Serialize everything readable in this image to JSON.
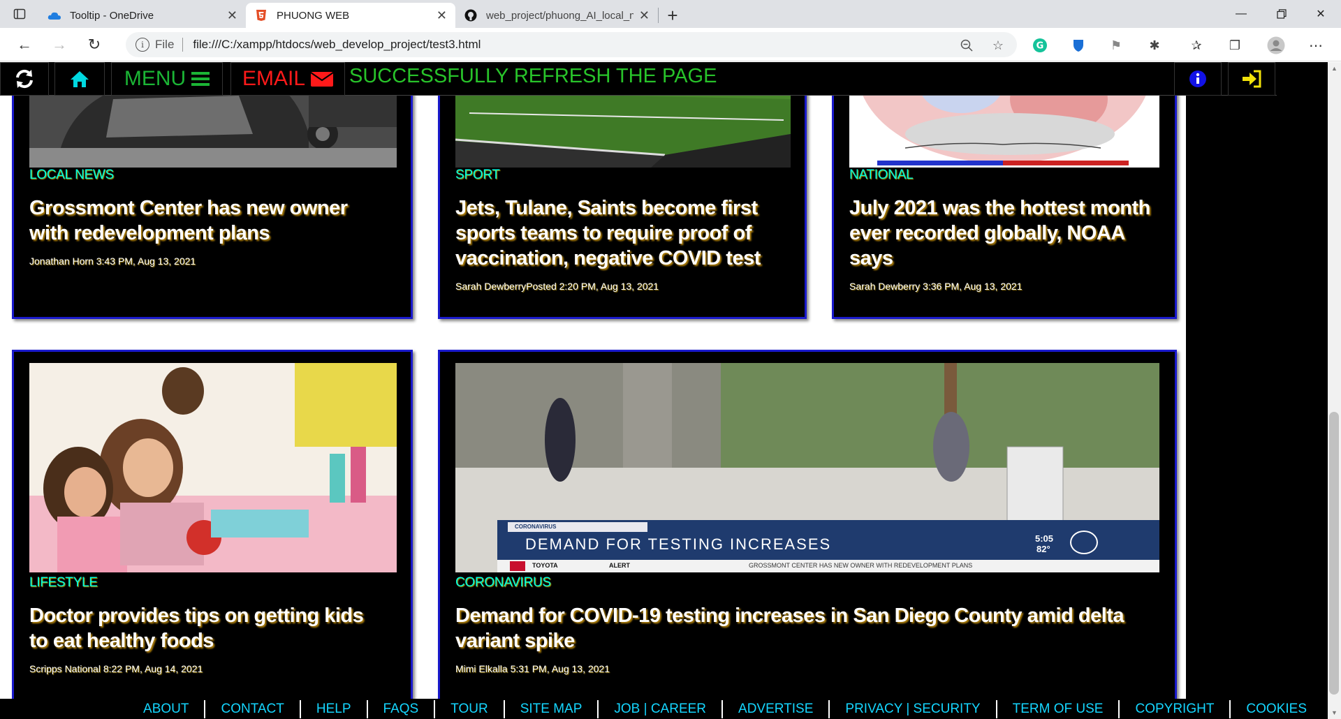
{
  "browser": {
    "tabs": [
      {
        "label": "Tooltip - OneDrive",
        "icon": "onedrive-cloud-icon"
      },
      {
        "label": "PHUONG WEB",
        "icon": "html5-icon"
      },
      {
        "label": "web_project/phuong_AI_local_ne",
        "icon": "github-icon"
      }
    ],
    "address": {
      "prefix": "File",
      "url": "file:///C:/xampp/htdocs/web_develop_project/test3.html"
    }
  },
  "topnav": {
    "menu_label": "MENU",
    "email_label": "EMAIL",
    "status": "SUCCESSFULLY REFRESH THE PAGE"
  },
  "cards": [
    {
      "category": "LOCAL NEWS",
      "title_l1": "Grossmont Center has new owner",
      "title_l2": "with redevelopment plans",
      "title_l3": "",
      "meta": "Jonathan Horn 3:43 PM, Aug 13, 2021"
    },
    {
      "category": "SPORT",
      "title_l1": "Jets, Tulane, Saints become first",
      "title_l2": "sports teams to require proof of",
      "title_l3": "vaccination, negative COVID test",
      "meta": "Sarah DewberryPosted 2:20 PM, Aug 13, 2021"
    },
    {
      "category": "NATIONAL",
      "title_l1": "July 2021 was the hottest month",
      "title_l2": "ever recorded globally, NOAA",
      "title_l3": "says",
      "meta": "Sarah Dewberry 3:36 PM, Aug 13, 2021"
    },
    {
      "category": "LIFESTYLE",
      "title_l1": "Doctor provides tips on getting kids",
      "title_l2": "to eat healthy foods",
      "title_l3": "",
      "meta": "Scripps National 8:22 PM, Aug 14, 2021"
    },
    {
      "category": "CORONAVIRUS",
      "title_l1": "Demand for COVID-19 testing increases in San Diego County amid delta",
      "title_l2": "variant spike",
      "title_l3": "",
      "meta": "Mimi Elkalla 5:31 PM, Aug 13, 2021"
    }
  ],
  "tv_banner": {
    "tag": "CORONAVIRUS",
    "headline": "DEMAND FOR TESTING INCREASES",
    "time": "5:05",
    "temp": "82°",
    "sponsor": "TOYOTA",
    "alert": "ALERT",
    "ticker": "GROSSMONT CENTER HAS NEW OWNER WITH REDEVELOPMENT PLANS"
  },
  "footer": [
    "ABOUT",
    "CONTACT",
    "HELP",
    "FAQS",
    "TOUR",
    "SITE MAP",
    "JOB | CAREER",
    "ADVERTISE",
    "PRIVACY | SECURITY",
    "TERM OF USE",
    "COPYRIGHT",
    "COOKIES"
  ],
  "colors": {
    "accent_cyan": "#00ffe0",
    "menu_green": "#1bb535",
    "email_red": "#ff1a1a",
    "card_border": "#1a1acc",
    "footer_link": "#15d6ff"
  }
}
